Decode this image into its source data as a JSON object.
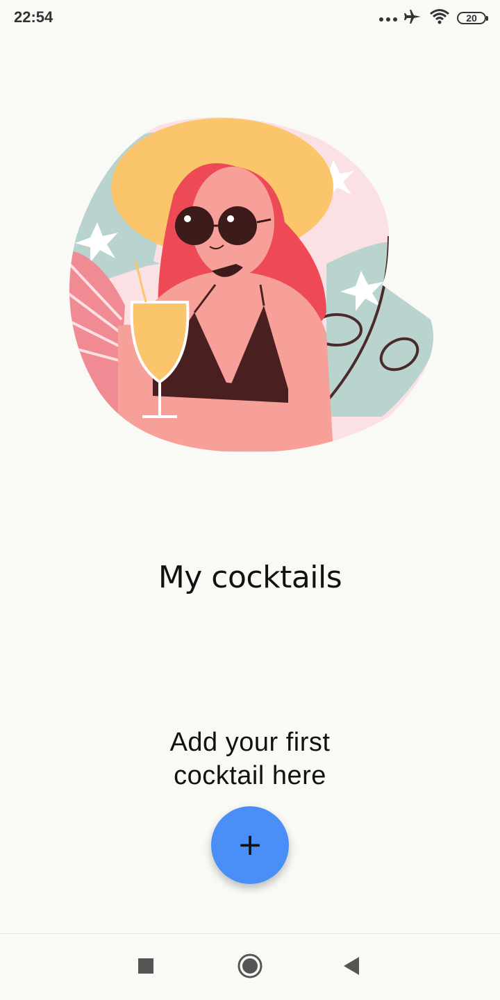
{
  "status_bar": {
    "time": "22:54",
    "battery_level": "20",
    "icons": [
      "more-dots-icon",
      "airplane-icon",
      "wifi-icon",
      "battery-icon"
    ]
  },
  "main": {
    "title": "My cocktails",
    "empty_message_line1": "Add your first",
    "empty_message_line2": "cocktail here",
    "fab_label": "+",
    "fab_color": "#4a8ff7",
    "illustration": "woman-with-cocktail-illustration"
  },
  "nav_bar": {
    "buttons": [
      "recents-square-icon",
      "home-circle-icon",
      "back-triangle-icon"
    ]
  }
}
